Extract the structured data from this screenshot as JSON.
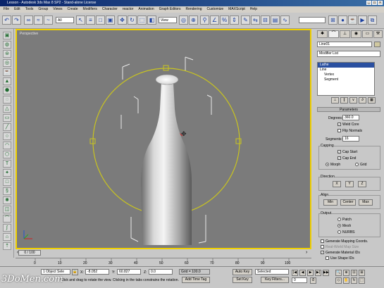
{
  "window": {
    "title": "Lesson - Autodesk 3ds Max 8 SP2 - Stand-alone License"
  },
  "menu": [
    "File",
    "Edit",
    "Tools",
    "Group",
    "Views",
    "Create",
    "Modifiers",
    "Character",
    "reactor",
    "Animation",
    "Graph Editors",
    "Rendering",
    "Customize",
    "MAXScript",
    "Help"
  ],
  "toolbar": {
    "ref_coord": "View",
    "selection_filter": "All",
    "named_selection": ""
  },
  "viewport": {
    "label": "Perspective"
  },
  "panel": {
    "object_name": "Line01",
    "modifier_list": "Modifier List",
    "stack": [
      "Lathe",
      "Line",
      "Vertex",
      "Segment"
    ],
    "parameters": {
      "header": "Parameters",
      "degrees_label": "Degrees:",
      "degrees_value": "360.0",
      "weld_core": "Weld Core",
      "flip_normals": "Flip Normals",
      "segments_label": "Segments:",
      "segments_value": "16",
      "capping_label": "Capping",
      "cap_start": "Cap Start",
      "cap_end": "Cap End",
      "morph": "Morph",
      "grid": "Grid",
      "direction_label": "Direction",
      "dir_x": "X",
      "dir_y": "Y",
      "dir_z": "Z",
      "align_label": "Align",
      "align_min": "Min",
      "align_center": "Center",
      "align_max": "Max",
      "output_label": "Output",
      "patch": "Patch",
      "mesh": "Mesh",
      "nurbs": "NURBS",
      "gen_mapping": "Generate Mapping Coords.",
      "real_world": "Real-World Map Size",
      "gen_material": "Generate Material IDs",
      "use_shape": "Use Shape IDs"
    }
  },
  "timeline": {
    "slider": "0 / 100",
    "ticks": [
      "0",
      "10",
      "20",
      "30",
      "40",
      "50",
      "60",
      "70",
      "80",
      "90",
      "100"
    ]
  },
  "status": {
    "selected": "1 Object Sele",
    "x_label": "X:",
    "x_value": "-8.052",
    "y_label": "Y:",
    "y_value": "60.827",
    "z_label": "Z:",
    "z_value": "0.0",
    "grid": "Grid = 100.0",
    "autokey": "Auto Key",
    "selected_dd": "Selected",
    "setkey": "Set Key",
    "keyfilters": "Key Filters...",
    "prompt": "Click and drag to rotate the view.  Clicking in the tabs constrains the rotation.",
    "add_time_tag": "Add Time Tag",
    "frame": "0"
  },
  "watermark": "3DoMen.com"
}
